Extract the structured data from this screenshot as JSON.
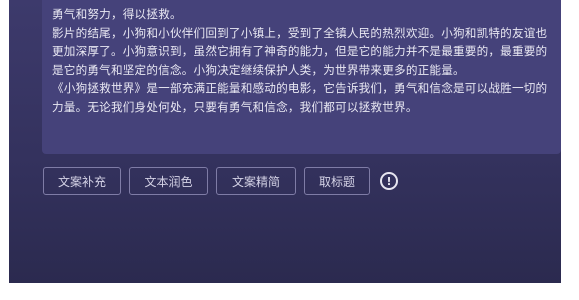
{
  "story": {
    "paragraphs": [
      "勇气和努力，得以拯救。",
      "影片的结尾，小狗和小伙伴们回到了小镇上，受到了全镇人民的热烈欢迎。小狗和凯特的友谊也更加深厚了。小狗意识到，虽然它拥有了神奇的能力，但是它的能力并不是最重要的，最重要的是它的勇气和坚定的信念。小狗决定继续保护人类，为世界带来更多的正能量。",
      "《小狗拯救世界》是一部充满正能量和感动的电影，它告诉我们，勇气和信念是可以战胜一切的力量。无论我们身处何处，只要有勇气和信念，我们都可以拯救世界。"
    ]
  },
  "actions": {
    "supplement_label": "文案补充",
    "polish_label": "文本润色",
    "condense_label": "文案精简",
    "title_label": "取标题"
  },
  "icons": {
    "info": "info-icon"
  },
  "colors": {
    "background": "#3d3a6c",
    "panel": "#45427a",
    "text": "#e9e8f3",
    "button_border": "#7f7ca6"
  }
}
